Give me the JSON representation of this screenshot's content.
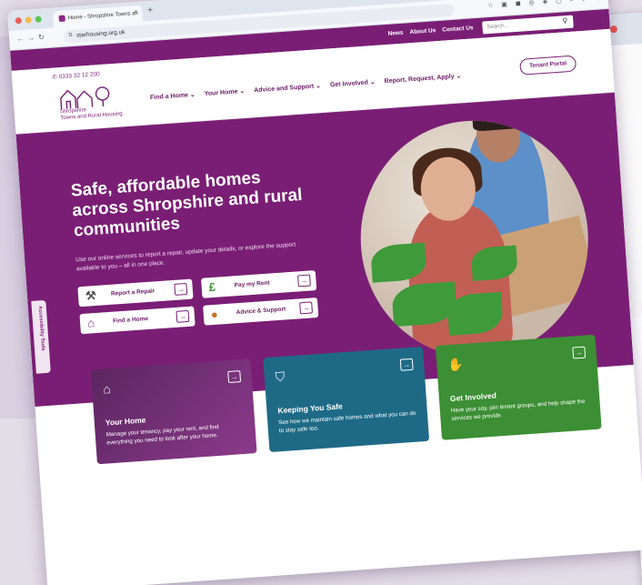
{
  "browser": {
    "tab_title": "Home - Shropshire Towns an",
    "url": "starhousing.org.uk",
    "new_tab_symbol": "+",
    "tab_close": "×"
  },
  "topbar": {
    "links": [
      "News",
      "About Us",
      "Contact Us"
    ],
    "search_placeholder": "Search..."
  },
  "header": {
    "phone": "0333 32 12 200",
    "logo_text": [
      "Shropshire",
      "Towns and Rural Housing"
    ],
    "nav": [
      "Find a Home ⌄",
      "Your Home ⌄",
      "Advice and Support ⌄",
      "Get Involved ⌄",
      "Report, Request, Apply ⌄"
    ],
    "portal_button": "Tenant Portal"
  },
  "hero": {
    "title": "Safe, affordable homes across Shropshire and rural communities",
    "subtitle": "Use our online services to report a repair, update your details, or explore the support available to you – all in one place.",
    "buttons": [
      {
        "label": "Report a Repair",
        "icon": "tools-icon"
      },
      {
        "label": "Pay my Rent",
        "icon": "pound-icon"
      },
      {
        "label": "Find a Home",
        "icon": "house-icon"
      },
      {
        "label": "Advice & Support",
        "icon": "chat-icon"
      }
    ]
  },
  "accessibility_tab": "Accessibility Tools",
  "cards": [
    {
      "title": "Your Home",
      "text": "Manage your tenancy, pay your rent, and find everything you need to look after your home.",
      "color": "#7a2a78"
    },
    {
      "title": "Keeping You Safe",
      "text": "See how we maintain safe homes and what you can do to stay safe too.",
      "color": "#1e6a86"
    },
    {
      "title": "Get Involved",
      "text": "Have your say, join tenant groups, and help shape the services we provide.",
      "color": "#3c8f34"
    }
  ],
  "colors": {
    "brand": "#7a1e75",
    "accent_green": "#3c8f34",
    "accent_blue": "#1e6a86"
  }
}
